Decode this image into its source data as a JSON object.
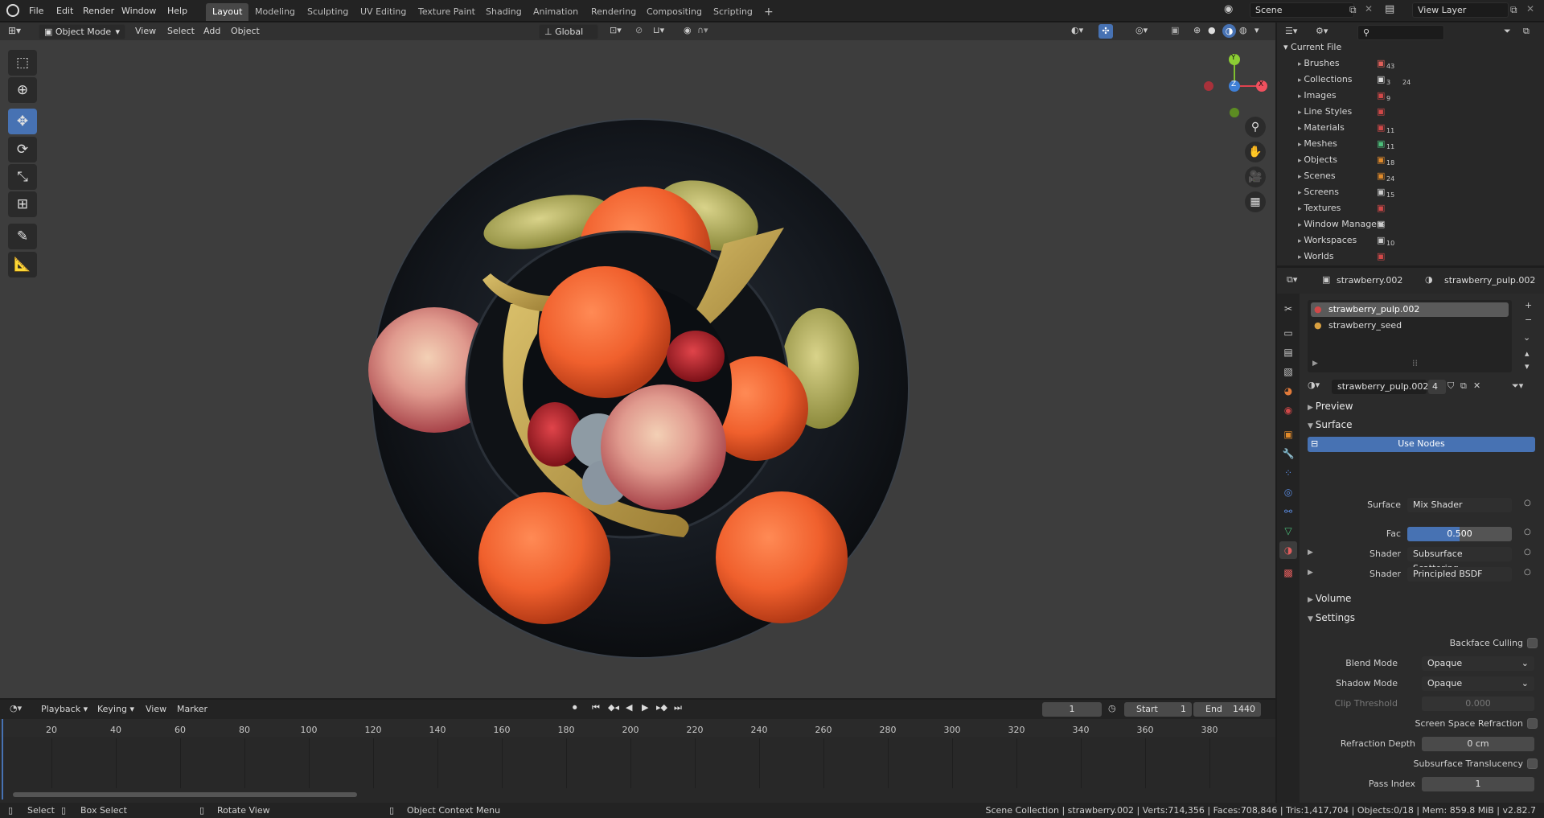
{
  "topbar": {
    "menus": [
      "File",
      "Edit",
      "Render",
      "Window",
      "Help"
    ],
    "workspaces": [
      "Layout",
      "Modeling",
      "Sculpting",
      "UV Editing",
      "Texture Paint",
      "Shading",
      "Animation",
      "Rendering",
      "Compositing",
      "Scripting"
    ],
    "active_workspace": "Layout",
    "add_tab": "+",
    "scene": "Scene",
    "view_layer": "View Layer"
  },
  "viewport_header": {
    "mode": "Object Mode",
    "menus": [
      "View",
      "Select",
      "Add",
      "Object"
    ],
    "transform": "Global"
  },
  "gizmo": {
    "y": "Y",
    "z": "Z",
    "x": "X"
  },
  "outliner": {
    "search_placeholder": "",
    "root": "Current File",
    "items": [
      {
        "label": "Brushes",
        "count": "43"
      },
      {
        "label": "Collections",
        "count": "3",
        "count2": "24"
      },
      {
        "label": "Images",
        "count": "9"
      },
      {
        "label": "Line Styles",
        "count": ""
      },
      {
        "label": "Materials",
        "count": "11"
      },
      {
        "label": "Meshes",
        "count": "11"
      },
      {
        "label": "Objects",
        "count": "18"
      },
      {
        "label": "Scenes",
        "count": "24"
      },
      {
        "label": "Screens",
        "count": "15"
      },
      {
        "label": "Textures",
        "count": ""
      },
      {
        "label": "Window Managers",
        "count": ""
      },
      {
        "label": "Workspaces",
        "count": "10"
      },
      {
        "label": "Worlds",
        "count": ""
      }
    ]
  },
  "properties": {
    "object": "strawberry.002",
    "material": "strawberry_pulp.002",
    "slots": [
      "strawberry_pulp.002",
      "strawberry_seed"
    ],
    "material_field": "strawberry_pulp.002",
    "users": "4",
    "sections": {
      "preview": "Preview",
      "surface": "Surface",
      "volume": "Volume",
      "settings": "Settings"
    },
    "use_nodes": "Use Nodes",
    "surface_label": "Surface",
    "surface_value": "Mix Shader",
    "fac_label": "Fac",
    "fac_value": "0.500",
    "fac_fraction": 0.5,
    "shader1_label": "Shader",
    "shader1_value": "Subsurface Scattering",
    "shader2_label": "Shader",
    "shader2_value": "Principled BSDF",
    "backface": "Backface Culling",
    "blend_label": "Blend Mode",
    "blend_value": "Opaque",
    "shadow_label": "Shadow Mode",
    "shadow_value": "Opaque",
    "clip_label": "Clip Threshold",
    "clip_value": "0.000",
    "ssr": "Screen Space Refraction",
    "refr_label": "Refraction Depth",
    "refr_value": "0 cm",
    "sst": "Subsurface Translucency",
    "pass_label": "Pass Index",
    "pass_value": "1"
  },
  "timeline": {
    "menus": [
      "Playback",
      "Keying",
      "View",
      "Marker"
    ],
    "current_frame": "1",
    "start_label": "Start",
    "start_value": "1",
    "end_label": "End",
    "end_value": "1440",
    "ticks": [
      "20",
      "40",
      "60",
      "80",
      "100",
      "120",
      "140",
      "160",
      "180",
      "200",
      "220",
      "240",
      "260",
      "280",
      "300",
      "320",
      "340",
      "360",
      "380"
    ]
  },
  "statusbar": {
    "select": "Select",
    "box_select": "Box Select",
    "rotate": "Rotate View",
    "context": "Object Context Menu",
    "stats": "Scene Collection | strawberry.002 | Verts:714,356 | Faces:708,846 | Tris:1,417,704 | Objects:0/18 | Mem: 859.8 MiB | v2.82.7"
  }
}
